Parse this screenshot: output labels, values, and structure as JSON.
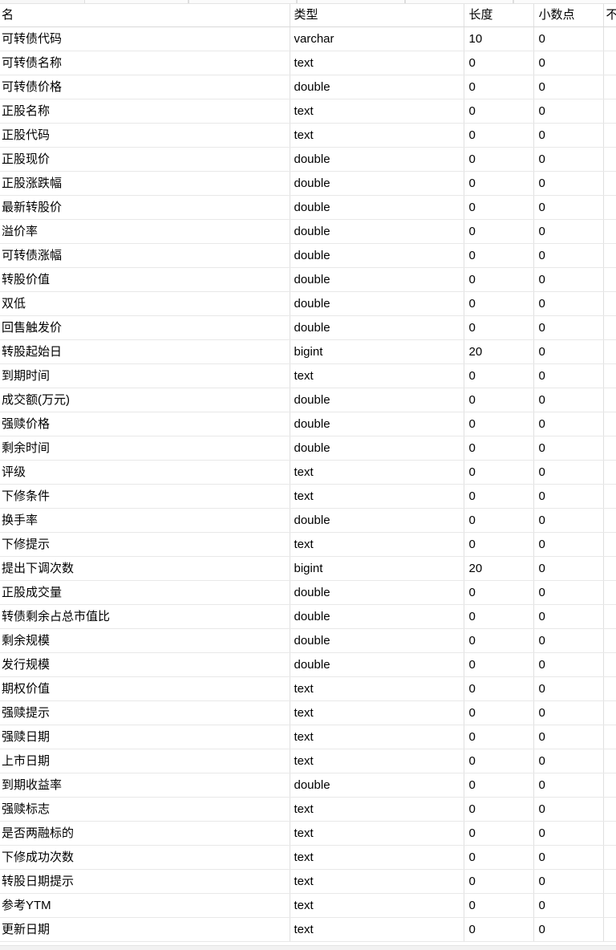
{
  "window": {
    "top_strip_segments": 6
  },
  "table": {
    "headers": {
      "name": "名",
      "type": "类型",
      "length": "长度",
      "decimals": "小数点",
      "not_null": "不"
    },
    "rows": [
      {
        "name": "可转债代码",
        "type": "varchar",
        "length": "10",
        "decimals": "0",
        "not_null": ""
      },
      {
        "name": "可转债名称",
        "type": "text",
        "length": "0",
        "decimals": "0",
        "not_null": ""
      },
      {
        "name": "可转债价格",
        "type": "double",
        "length": "0",
        "decimals": "0",
        "not_null": ""
      },
      {
        "name": "正股名称",
        "type": "text",
        "length": "0",
        "decimals": "0",
        "not_null": ""
      },
      {
        "name": "正股代码",
        "type": "text",
        "length": "0",
        "decimals": "0",
        "not_null": ""
      },
      {
        "name": "正股现价",
        "type": "double",
        "length": "0",
        "decimals": "0",
        "not_null": ""
      },
      {
        "name": "正股涨跌幅",
        "type": "double",
        "length": "0",
        "decimals": "0",
        "not_null": ""
      },
      {
        "name": "最新转股价",
        "type": "double",
        "length": "0",
        "decimals": "0",
        "not_null": ""
      },
      {
        "name": "溢价率",
        "type": "double",
        "length": "0",
        "decimals": "0",
        "not_null": ""
      },
      {
        "name": "可转债涨幅",
        "type": "double",
        "length": "0",
        "decimals": "0",
        "not_null": ""
      },
      {
        "name": "转股价值",
        "type": "double",
        "length": "0",
        "decimals": "0",
        "not_null": ""
      },
      {
        "name": "双低",
        "type": "double",
        "length": "0",
        "decimals": "0",
        "not_null": ""
      },
      {
        "name": "回售触发价",
        "type": "double",
        "length": "0",
        "decimals": "0",
        "not_null": ""
      },
      {
        "name": "转股起始日",
        "type": "bigint",
        "length": "20",
        "decimals": "0",
        "not_null": ""
      },
      {
        "name": "到期时间",
        "type": "text",
        "length": "0",
        "decimals": "0",
        "not_null": ""
      },
      {
        "name": "成交额(万元)",
        "type": "double",
        "length": "0",
        "decimals": "0",
        "not_null": ""
      },
      {
        "name": "强赎价格",
        "type": "double",
        "length": "0",
        "decimals": "0",
        "not_null": ""
      },
      {
        "name": "剩余时间",
        "type": "double",
        "length": "0",
        "decimals": "0",
        "not_null": ""
      },
      {
        "name": "评级",
        "type": "text",
        "length": "0",
        "decimals": "0",
        "not_null": ""
      },
      {
        "name": "下修条件",
        "type": "text",
        "length": "0",
        "decimals": "0",
        "not_null": ""
      },
      {
        "name": "换手率",
        "type": "double",
        "length": "0",
        "decimals": "0",
        "not_null": ""
      },
      {
        "name": "下修提示",
        "type": "text",
        "length": "0",
        "decimals": "0",
        "not_null": ""
      },
      {
        "name": "提出下调次数",
        "type": "bigint",
        "length": "20",
        "decimals": "0",
        "not_null": ""
      },
      {
        "name": "正股成交量",
        "type": "double",
        "length": "0",
        "decimals": "0",
        "not_null": ""
      },
      {
        "name": "转债剩余占总市值比",
        "type": "double",
        "length": "0",
        "decimals": "0",
        "not_null": ""
      },
      {
        "name": "剩余规模",
        "type": "double",
        "length": "0",
        "decimals": "0",
        "not_null": ""
      },
      {
        "name": "发行规模",
        "type": "double",
        "length": "0",
        "decimals": "0",
        "not_null": ""
      },
      {
        "name": "期权价值",
        "type": "text",
        "length": "0",
        "decimals": "0",
        "not_null": ""
      },
      {
        "name": "强赎提示",
        "type": "text",
        "length": "0",
        "decimals": "0",
        "not_null": ""
      },
      {
        "name": "强赎日期",
        "type": "text",
        "length": "0",
        "decimals": "0",
        "not_null": ""
      },
      {
        "name": "上市日期",
        "type": "text",
        "length": "0",
        "decimals": "0",
        "not_null": ""
      },
      {
        "name": "到期收益率",
        "type": "double",
        "length": "0",
        "decimals": "0",
        "not_null": ""
      },
      {
        "name": "强赎标志",
        "type": "text",
        "length": "0",
        "decimals": "0",
        "not_null": ""
      },
      {
        "name": "是否两融标的",
        "type": "text",
        "length": "0",
        "decimals": "0",
        "not_null": ""
      },
      {
        "name": "下修成功次数",
        "type": "text",
        "length": "0",
        "decimals": "0",
        "not_null": ""
      },
      {
        "name": "转股日期提示",
        "type": "text",
        "length": "0",
        "decimals": "0",
        "not_null": ""
      },
      {
        "name": "参考YTM",
        "type": "text",
        "length": "0",
        "decimals": "0",
        "not_null": ""
      },
      {
        "name": "更新日期",
        "type": "text",
        "length": "0",
        "decimals": "0",
        "not_null": ""
      }
    ]
  }
}
